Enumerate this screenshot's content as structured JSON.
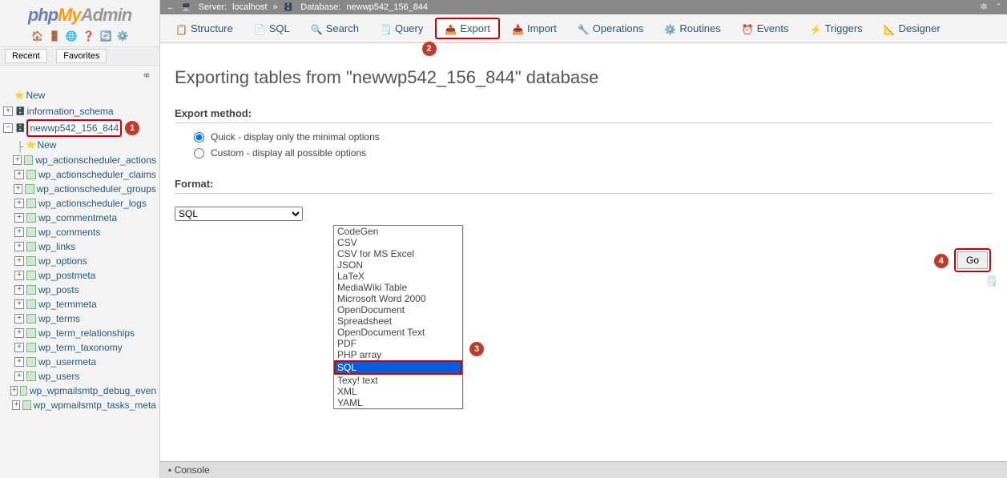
{
  "sidebar": {
    "logo": {
      "php": "php",
      "my": "My",
      "admin": "Admin"
    },
    "tabs": {
      "recent": "Recent",
      "favorites": "Favorites"
    },
    "tree": {
      "new": "New",
      "info_schema": "information_schema",
      "db": "newwp542_156_844",
      "new_table": "New",
      "tables": [
        "wp_actionscheduler_actions",
        "wp_actionscheduler_claims",
        "wp_actionscheduler_groups",
        "wp_actionscheduler_logs",
        "wp_commentmeta",
        "wp_comments",
        "wp_links",
        "wp_options",
        "wp_postmeta",
        "wp_posts",
        "wp_termmeta",
        "wp_terms",
        "wp_term_relationships",
        "wp_term_taxonomy",
        "wp_usermeta",
        "wp_users",
        "wp_wpmailsmtp_debug_even",
        "wp_wpmailsmtp_tasks_meta"
      ]
    }
  },
  "badges": {
    "1": "1",
    "2": "2",
    "3": "3",
    "4": "4"
  },
  "breadcrumb": {
    "server_lbl": "Server:",
    "server_val": "localhost",
    "sep": "»",
    "db_lbl": "Database:",
    "db_val": "newwp542_156_844"
  },
  "topnav": {
    "structure": "Structure",
    "sql": "SQL",
    "search": "Search",
    "query": "Query",
    "export": "Export",
    "import": "Import",
    "operations": "Operations",
    "routines": "Routines",
    "events": "Events",
    "triggers": "Triggers",
    "designer": "Designer"
  },
  "page": {
    "title": "Exporting tables from \"newwp542_156_844\" database",
    "export_method_h": "Export method:",
    "quick": "Quick - display only the minimal options",
    "custom": "Custom - display all possible options",
    "format_h": "Format:",
    "format_selected": "SQL",
    "format_options": [
      "CodeGen",
      "CSV",
      "CSV for MS Excel",
      "JSON",
      "LaTeX",
      "MediaWiki Table",
      "Microsoft Word 2000",
      "OpenDocument Spreadsheet",
      "OpenDocument Text",
      "PDF",
      "PHP array",
      "SQL",
      "Texy! text",
      "XML",
      "YAML"
    ],
    "go": "Go",
    "console": "Console"
  }
}
